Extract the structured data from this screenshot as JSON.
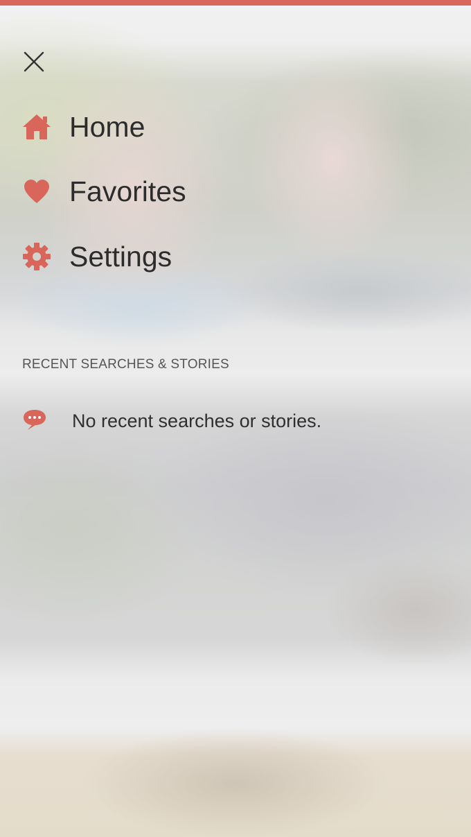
{
  "colors": {
    "accent": "#d9665a",
    "text": "#2c2c2c",
    "muted": "#555555"
  },
  "menu": {
    "close_icon": "close-icon",
    "items": [
      {
        "label": "Home",
        "icon": "home-icon"
      },
      {
        "label": "Favorites",
        "icon": "heart-icon"
      },
      {
        "label": "Settings",
        "icon": "gear-icon"
      }
    ]
  },
  "recent": {
    "header": "RECENT SEARCHES & STORIES",
    "empty_message": "No recent searches or stories.",
    "icon": "chat-bubble-icon"
  }
}
